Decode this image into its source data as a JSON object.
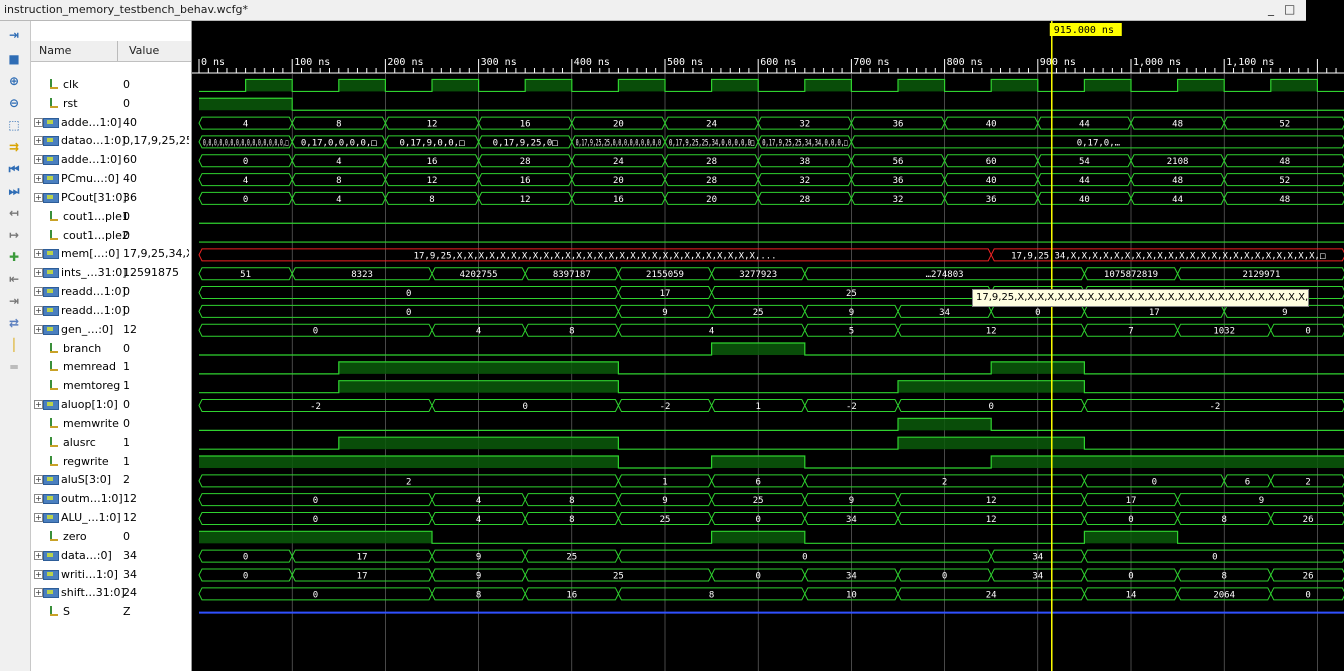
{
  "window": {
    "title": "instruction_memory_testbench_behav.wcfg*",
    "controls": [
      "_",
      "□"
    ]
  },
  "columns": {
    "name": "Name",
    "value": "Value"
  },
  "cursor": {
    "label": "915.000 ns",
    "time": 915
  },
  "timeline": {
    "labels": [
      "0 ns",
      "100 ns",
      "200 ns",
      "300 ns",
      "400 ns",
      "500 ns",
      "600 ns",
      "700 ns",
      "800 ns",
      "900 ns",
      "1,000 ns",
      "1,100 ns"
    ]
  },
  "tooltip": "17,9,25,X,X,X,X,X,X,X,X,X,X,X,X,X,X,X,X,X,X,X,X,X,X,X,X,X,X,X,X,X,X,X,X,X,...",
  "toolbar": [
    "zoom-fit-icon",
    "save-icon",
    "zoom-in-icon",
    "zoom-out-icon",
    "zoom-full-icon",
    "goto-cursor-icon",
    "goto-start-icon",
    "goto-end-icon",
    "previous-transition-icon",
    "next-transition-icon",
    "add-marker-icon",
    "previous-marker-icon",
    "next-marker-icon",
    "swap-cursors-icon",
    "snap-transition-icon",
    "floating-ruler-icon"
  ],
  "signals": [
    {
      "name": "clk",
      "value": "0",
      "bus": false
    },
    {
      "name": "rst",
      "value": "0",
      "bus": false
    },
    {
      "name": "adde…1:0]",
      "value": "40",
      "bus": true
    },
    {
      "name": "datao…1:0]",
      "value": "0,17,9,25,25,3",
      "bus": true
    },
    {
      "name": "adde…1:0]",
      "value": "60",
      "bus": true
    },
    {
      "name": "PCmu…:0]",
      "value": "40",
      "bus": true
    },
    {
      "name": "PCout[31:0]",
      "value": "36",
      "bus": true
    },
    {
      "name": "cout1…ple1",
      "value": "0",
      "bus": false
    },
    {
      "name": "cout1…ple2",
      "value": "0",
      "bus": false
    },
    {
      "name": "mem[…:0]",
      "value": "17,9,25,34,X,X",
      "bus": true
    },
    {
      "name": "ints_…31:0]",
      "value": "12591875",
      "bus": true
    },
    {
      "name": "readd…1:0]",
      "value": "0",
      "bus": true
    },
    {
      "name": "readd…1:0]",
      "value": "0",
      "bus": true
    },
    {
      "name": "gen_…:0]",
      "value": "12",
      "bus": true
    },
    {
      "name": "branch",
      "value": "0",
      "bus": false
    },
    {
      "name": "memread",
      "value": "1",
      "bus": false
    },
    {
      "name": "memtoreg",
      "value": "1",
      "bus": false
    },
    {
      "name": "aluop[1:0]",
      "value": "0",
      "bus": true
    },
    {
      "name": "memwrite",
      "value": "0",
      "bus": false
    },
    {
      "name": "alusrc",
      "value": "1",
      "bus": false
    },
    {
      "name": "regwrite",
      "value": "1",
      "bus": false
    },
    {
      "name": "aluS[3:0]",
      "value": "2",
      "bus": true
    },
    {
      "name": "outm…1:0]",
      "value": "12",
      "bus": true
    },
    {
      "name": "ALU_…1:0]",
      "value": "12",
      "bus": true
    },
    {
      "name": "zero",
      "value": "0",
      "bus": false
    },
    {
      "name": "data…:0]",
      "value": "34",
      "bus": true
    },
    {
      "name": "writi…1:0]",
      "value": "34",
      "bus": true
    },
    {
      "name": "shift…31:0]",
      "value": "24",
      "bus": true
    },
    {
      "name": "S",
      "value": "Z",
      "bus": false
    }
  ],
  "waves": [
    {
      "kind": "bit",
      "segs": [
        [
          0,
          50,
          0
        ],
        [
          50,
          100,
          1
        ],
        [
          100,
          150,
          0
        ],
        [
          150,
          200,
          1
        ],
        [
          200,
          250,
          0
        ],
        [
          250,
          300,
          1
        ],
        [
          300,
          350,
          0
        ],
        [
          350,
          400,
          1
        ],
        [
          400,
          450,
          0
        ],
        [
          450,
          500,
          1
        ],
        [
          500,
          550,
          0
        ],
        [
          550,
          600,
          1
        ],
        [
          600,
          650,
          0
        ],
        [
          650,
          700,
          1
        ],
        [
          700,
          750,
          0
        ],
        [
          750,
          800,
          1
        ],
        [
          800,
          850,
          0
        ],
        [
          850,
          900,
          1
        ],
        [
          900,
          950,
          0
        ],
        [
          950,
          1000,
          1
        ],
        [
          1000,
          1050,
          0
        ],
        [
          1050,
          1100,
          1
        ],
        [
          1100,
          1150,
          0
        ],
        [
          1150,
          1200,
          1
        ],
        [
          1200,
          1230,
          0
        ]
      ]
    },
    {
      "kind": "bit",
      "segs": [
        [
          0,
          100,
          1
        ],
        [
          100,
          1230,
          0
        ]
      ]
    },
    {
      "kind": "bus",
      "segs": [
        [
          0,
          100,
          "4"
        ],
        [
          100,
          200,
          "8"
        ],
        [
          200,
          300,
          "12"
        ],
        [
          300,
          400,
          "16"
        ],
        [
          400,
          500,
          "20"
        ],
        [
          500,
          600,
          "24"
        ],
        [
          600,
          700,
          "32"
        ],
        [
          700,
          800,
          "36"
        ],
        [
          800,
          900,
          "40"
        ],
        [
          900,
          1000,
          "44"
        ],
        [
          1000,
          1100,
          "48"
        ],
        [
          1100,
          1230,
          "52"
        ]
      ]
    },
    {
      "kind": "bus",
      "segs": [
        [
          0,
          100,
          "0,0,0,0,0,0,0,0,0,0,0,0,0,0,0,□"
        ],
        [
          100,
          200,
          "0,17,0,0,0,0,□"
        ],
        [
          200,
          300,
          "0,17,9,0,0,□"
        ],
        [
          300,
          400,
          "0,17,9,25,0□"
        ],
        [
          400,
          500,
          "0,17,9,25,25,0,0,0,0,0,0,0,0,0"
        ],
        [
          500,
          600,
          "0,17,9,25,25,34,0,0,0,0,0□"
        ],
        [
          600,
          700,
          "0,17,9,25,25,34,34,0,0,0,□"
        ],
        [
          700,
          1230,
          "0,17,0,…"
        ]
      ]
    },
    {
      "kind": "bus",
      "segs": [
        [
          0,
          100,
          "0"
        ],
        [
          100,
          200,
          "4"
        ],
        [
          200,
          300,
          "16"
        ],
        [
          300,
          400,
          "28"
        ],
        [
          400,
          500,
          "24"
        ],
        [
          500,
          600,
          "28"
        ],
        [
          600,
          700,
          "38"
        ],
        [
          700,
          800,
          "56"
        ],
        [
          800,
          900,
          "60"
        ],
        [
          900,
          1000,
          "54"
        ],
        [
          1000,
          1100,
          "2108"
        ],
        [
          1100,
          1230,
          "48"
        ]
      ]
    },
    {
      "kind": "bus",
      "segs": [
        [
          0,
          100,
          "4"
        ],
        [
          100,
          200,
          "8"
        ],
        [
          200,
          300,
          "12"
        ],
        [
          300,
          400,
          "16"
        ],
        [
          400,
          500,
          "20"
        ],
        [
          500,
          600,
          "28"
        ],
        [
          600,
          700,
          "32"
        ],
        [
          700,
          800,
          "36"
        ],
        [
          800,
          900,
          "40"
        ],
        [
          900,
          1000,
          "44"
        ],
        [
          1000,
          1100,
          "48"
        ],
        [
          1100,
          1230,
          "52"
        ]
      ]
    },
    {
      "kind": "bus",
      "segs": [
        [
          0,
          100,
          "0"
        ],
        [
          100,
          200,
          "4"
        ],
        [
          200,
          300,
          "8"
        ],
        [
          300,
          400,
          "12"
        ],
        [
          400,
          500,
          "16"
        ],
        [
          500,
          600,
          "20"
        ],
        [
          600,
          700,
          "28"
        ],
        [
          700,
          800,
          "32"
        ],
        [
          800,
          900,
          "36"
        ],
        [
          900,
          1000,
          "40"
        ],
        [
          1000,
          1100,
          "44"
        ],
        [
          1100,
          1230,
          "48"
        ]
      ]
    },
    {
      "kind": "bit",
      "segs": [
        [
          0,
          1230,
          0
        ]
      ]
    },
    {
      "kind": "bit",
      "segs": [
        [
          0,
          1230,
          0
        ]
      ]
    },
    {
      "kind": "bus",
      "err": true,
      "segs": [
        [
          0,
          850,
          "17,9,25,X,X,X,X,X,X,X,X,X,X,X,X,X,X,X,X,X,X,X,X,X,X,X,X,X,X,X,X,..."
        ],
        [
          850,
          1230,
          "17,9,25,34,X,X,X,X,X,X,X,X,X,X,X,X,X,X,X,X,X,X,X,X,X,X,X,□"
        ]
      ]
    },
    {
      "kind": "bus",
      "segs": [
        [
          0,
          100,
          "51"
        ],
        [
          100,
          250,
          "8323"
        ],
        [
          250,
          350,
          "4202755"
        ],
        [
          350,
          450,
          "8397187"
        ],
        [
          450,
          550,
          "2155059"
        ],
        [
          550,
          650,
          "3277923"
        ],
        [
          650,
          950,
          "…274803"
        ],
        [
          950,
          1050,
          "1075872819"
        ],
        [
          1050,
          1230,
          "2129971"
        ]
      ]
    },
    {
      "kind": "bus",
      "segs": [
        [
          0,
          450,
          "0"
        ],
        [
          450,
          550,
          "17"
        ],
        [
          550,
          850,
          "25"
        ],
        [
          850,
          950,
          "0"
        ],
        [
          950,
          1230,
          "34"
        ]
      ]
    },
    {
      "kind": "bus",
      "segs": [
        [
          0,
          450,
          "0"
        ],
        [
          450,
          550,
          "9"
        ],
        [
          550,
          650,
          "25"
        ],
        [
          650,
          750,
          "9"
        ],
        [
          750,
          850,
          "34"
        ],
        [
          850,
          950,
          "0"
        ],
        [
          950,
          1100,
          "17"
        ],
        [
          1100,
          1230,
          "9"
        ]
      ]
    },
    {
      "kind": "bus",
      "segs": [
        [
          0,
          250,
          "0"
        ],
        [
          250,
          350,
          "4"
        ],
        [
          350,
          450,
          "8"
        ],
        [
          450,
          650,
          "4"
        ],
        [
          650,
          750,
          "5"
        ],
        [
          750,
          950,
          "12"
        ],
        [
          950,
          1050,
          "7"
        ],
        [
          1050,
          1150,
          "1032"
        ],
        [
          1150,
          1230,
          "0"
        ]
      ]
    },
    {
      "kind": "bit",
      "segs": [
        [
          0,
          550,
          0
        ],
        [
          550,
          650,
          1
        ],
        [
          650,
          1230,
          0
        ]
      ]
    },
    {
      "kind": "bit",
      "segs": [
        [
          0,
          150,
          0
        ],
        [
          150,
          450,
          1
        ],
        [
          450,
          850,
          0
        ],
        [
          850,
          950,
          1
        ],
        [
          950,
          1230,
          0
        ]
      ]
    },
    {
      "kind": "bit",
      "segs": [
        [
          0,
          150,
          0
        ],
        [
          150,
          450,
          1
        ],
        [
          450,
          750,
          0
        ],
        [
          750,
          950,
          1
        ],
        [
          950,
          1230,
          0
        ]
      ]
    },
    {
      "kind": "bus",
      "segs": [
        [
          0,
          250,
          "-2"
        ],
        [
          250,
          450,
          "0"
        ],
        [
          450,
          550,
          "-2"
        ],
        [
          550,
          650,
          "1"
        ],
        [
          650,
          750,
          "-2"
        ],
        [
          750,
          950,
          "0"
        ],
        [
          950,
          1230,
          "-2"
        ]
      ]
    },
    {
      "kind": "bit",
      "segs": [
        [
          0,
          750,
          0
        ],
        [
          750,
          850,
          1
        ],
        [
          850,
          1230,
          0
        ]
      ]
    },
    {
      "kind": "bit",
      "segs": [
        [
          0,
          150,
          0
        ],
        [
          150,
          450,
          1
        ],
        [
          450,
          750,
          0
        ],
        [
          750,
          950,
          1
        ],
        [
          950,
          1230,
          0
        ]
      ]
    },
    {
      "kind": "bit",
      "segs": [
        [
          0,
          450,
          1
        ],
        [
          450,
          550,
          0
        ],
        [
          550,
          650,
          1
        ],
        [
          650,
          850,
          0
        ],
        [
          850,
          1230,
          1
        ]
      ]
    },
    {
      "kind": "bus",
      "segs": [
        [
          0,
          450,
          "2"
        ],
        [
          450,
          550,
          "1"
        ],
        [
          550,
          650,
          "6"
        ],
        [
          650,
          950,
          "2"
        ],
        [
          950,
          1100,
          "0"
        ],
        [
          1100,
          1150,
          "6"
        ],
        [
          1150,
          1230,
          "2"
        ]
      ]
    },
    {
      "kind": "bus",
      "segs": [
        [
          0,
          250,
          "0"
        ],
        [
          250,
          350,
          "4"
        ],
        [
          350,
          450,
          "8"
        ],
        [
          450,
          550,
          "9"
        ],
        [
          550,
          650,
          "25"
        ],
        [
          650,
          750,
          "9"
        ],
        [
          750,
          950,
          "12"
        ],
        [
          950,
          1050,
          "17"
        ],
        [
          1050,
          1230,
          "9"
        ]
      ]
    },
    {
      "kind": "bus",
      "segs": [
        [
          0,
          250,
          "0"
        ],
        [
          250,
          350,
          "4"
        ],
        [
          350,
          450,
          "8"
        ],
        [
          450,
          550,
          "25"
        ],
        [
          550,
          650,
          "0"
        ],
        [
          650,
          750,
          "34"
        ],
        [
          750,
          950,
          "12"
        ],
        [
          950,
          1050,
          "0"
        ],
        [
          1050,
          1150,
          "8"
        ],
        [
          1150,
          1230,
          "26"
        ]
      ]
    },
    {
      "kind": "bit",
      "segs": [
        [
          0,
          250,
          1
        ],
        [
          250,
          550,
          0
        ],
        [
          550,
          650,
          1
        ],
        [
          650,
          950,
          0
        ],
        [
          950,
          1050,
          1
        ],
        [
          1050,
          1230,
          0
        ]
      ]
    },
    {
      "kind": "bus",
      "segs": [
        [
          0,
          100,
          "0"
        ],
        [
          100,
          250,
          "17"
        ],
        [
          250,
          350,
          "9"
        ],
        [
          350,
          450,
          "25"
        ],
        [
          450,
          850,
          "0"
        ],
        [
          850,
          950,
          "34"
        ],
        [
          950,
          1230,
          "0"
        ]
      ]
    },
    {
      "kind": "bus",
      "segs": [
        [
          0,
          100,
          "0"
        ],
        [
          100,
          250,
          "17"
        ],
        [
          250,
          350,
          "9"
        ],
        [
          350,
          550,
          "25"
        ],
        [
          550,
          650,
          "0"
        ],
        [
          650,
          750,
          "34"
        ],
        [
          750,
          850,
          "0"
        ],
        [
          850,
          950,
          "34"
        ],
        [
          950,
          1050,
          "0"
        ],
        [
          1050,
          1150,
          "8"
        ],
        [
          1150,
          1230,
          "26"
        ]
      ]
    },
    {
      "kind": "bus",
      "segs": [
        [
          0,
          250,
          "0"
        ],
        [
          250,
          350,
          "8"
        ],
        [
          350,
          450,
          "16"
        ],
        [
          450,
          650,
          "8"
        ],
        [
          650,
          750,
          "10"
        ],
        [
          750,
          950,
          "24"
        ],
        [
          950,
          1050,
          "14"
        ],
        [
          1050,
          1150,
          "2064"
        ],
        [
          1150,
          1230,
          "0"
        ]
      ]
    },
    {
      "kind": "z",
      "segs": [
        [
          0,
          1230,
          "Z"
        ]
      ]
    }
  ]
}
